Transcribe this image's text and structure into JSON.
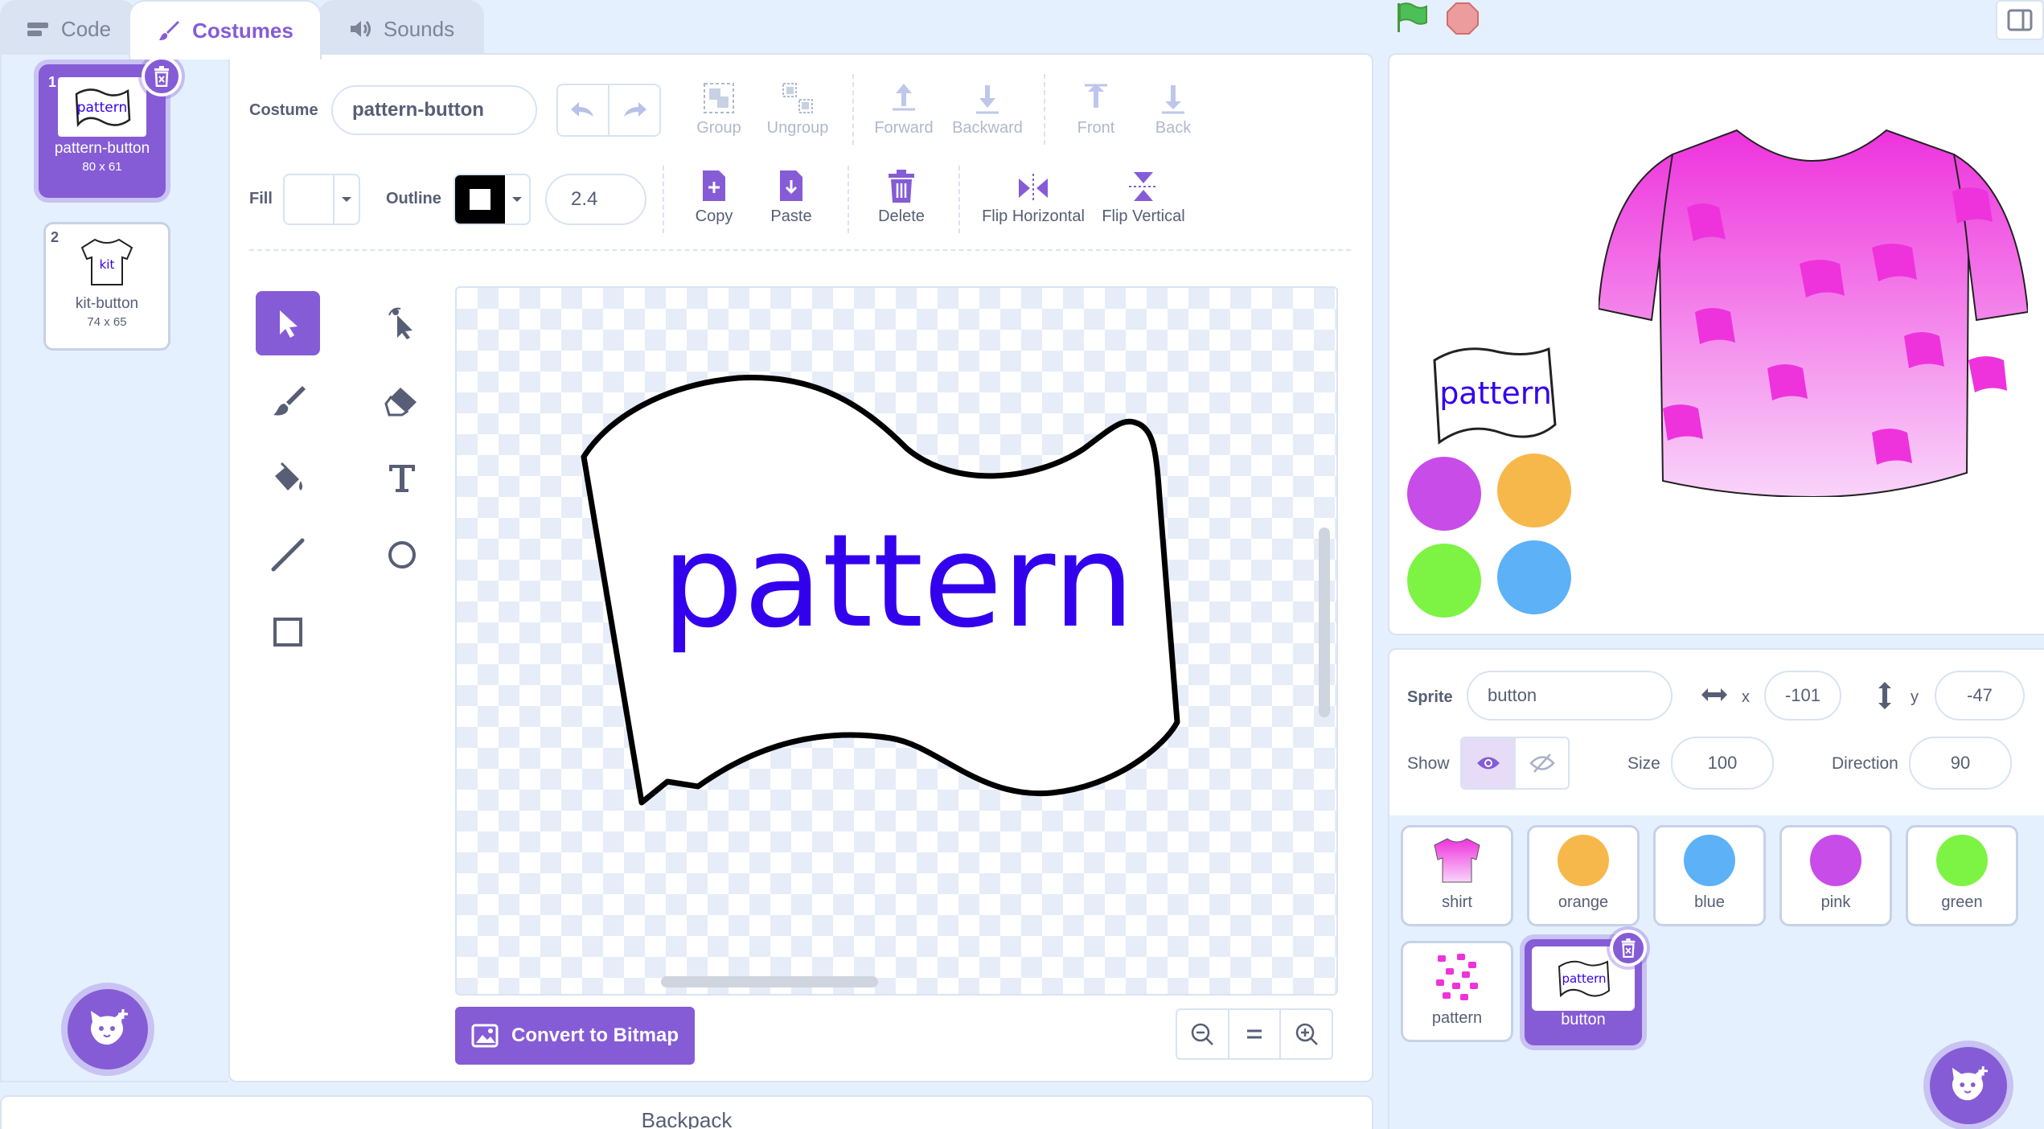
{
  "tabs": [
    {
      "label": "Code"
    },
    {
      "label": "Costumes"
    },
    {
      "label": "Sounds"
    }
  ],
  "costumes": [
    {
      "num": "1",
      "name": "pattern-button",
      "size": "80 x 61",
      "thumb_text": "pattern"
    },
    {
      "num": "2",
      "name": "kit-button",
      "size": "74 x 65",
      "thumb_text": "kit"
    }
  ],
  "toolbar": {
    "costume_label": "Costume",
    "costume_name": "pattern-button",
    "group": "Group",
    "ungroup": "Ungroup",
    "forward": "Forward",
    "backward": "Backward",
    "front": "Front",
    "back": "Back",
    "fill_label": "Fill",
    "outline_label": "Outline",
    "outline_width": "2.4",
    "copy": "Copy",
    "paste": "Paste",
    "delete": "Delete",
    "flip_h": "Flip Horizontal",
    "flip_v": "Flip Vertical"
  },
  "canvas": {
    "text": "pattern",
    "text_color": "#3300ee"
  },
  "convert_button": "Convert to Bitmap",
  "backpack": "Backpack",
  "stage": {
    "flag_text": "pattern"
  },
  "sprite_info": {
    "sprite_label": "Sprite",
    "sprite_name": "button",
    "x_label": "x",
    "x_value": "-101",
    "y_label": "y",
    "y_value": "-47",
    "show_label": "Show",
    "size_label": "Size",
    "size_value": "100",
    "direction_label": "Direction",
    "direction_value": "90"
  },
  "sprites": [
    {
      "name": "shirt"
    },
    {
      "name": "orange",
      "color": "#f7b84b"
    },
    {
      "name": "blue",
      "color": "#5cb1f7"
    },
    {
      "name": "pink",
      "color": "#c84ce8"
    },
    {
      "name": "green",
      "color": "#7df443"
    },
    {
      "name": "pattern"
    },
    {
      "name": "button",
      "thumb_text": "pattern"
    }
  ],
  "colors": {
    "accent": "#855cd6",
    "panel_bg": "#e5f0ff",
    "border": "#d9e3f2",
    "orange": "#f7b84b",
    "blue": "#5cb1f7",
    "pink": "#c84ce8",
    "green": "#7df443",
    "magenta": "#ee33dd"
  }
}
